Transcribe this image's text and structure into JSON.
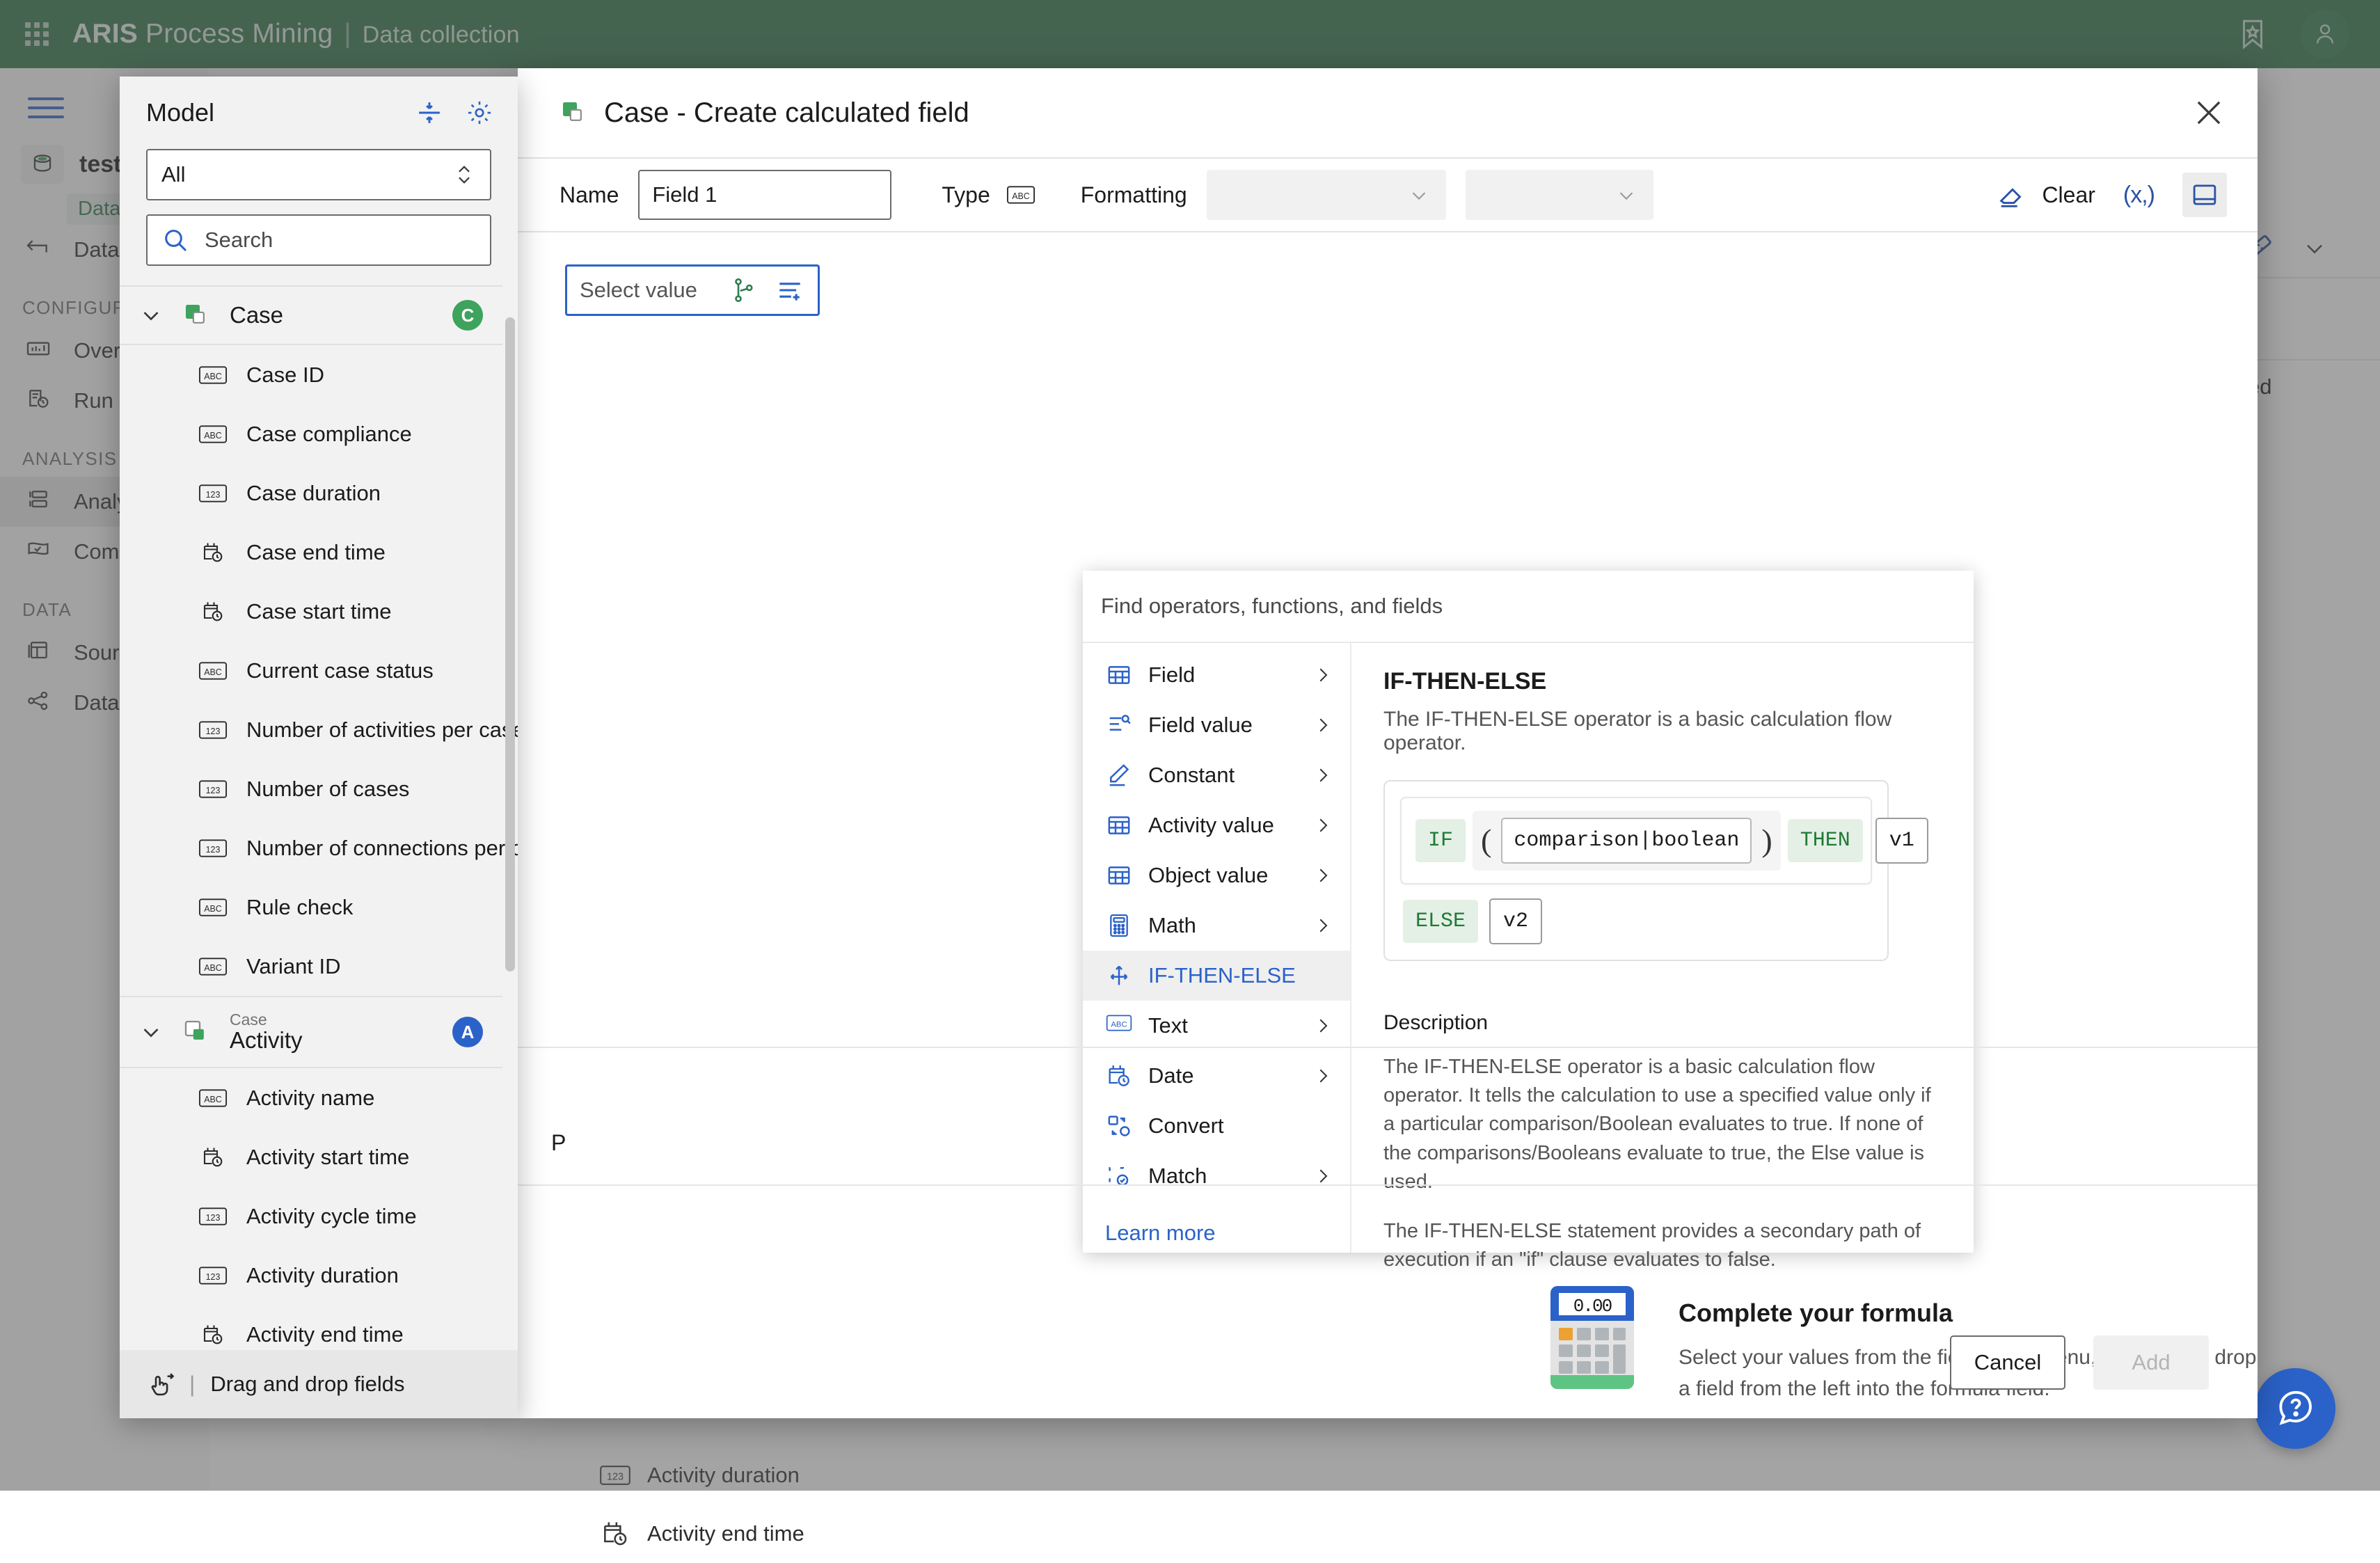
{
  "topbar": {
    "brand_bold": "ARIS",
    "brand_rest": " Process Mining",
    "separator": "|",
    "subtitle": "Data collection",
    "bookmark_icon": "bookmark-star-icon",
    "avatar_icon": "user-avatar-icon",
    "accent_color": "#2d7245"
  },
  "background_nav": {
    "db_name": "test",
    "chip": "Data ",
    "back_item": "Data s",
    "sections": [
      {
        "label": "CONFIGURA",
        "items": [
          "Overv",
          "Run lo"
        ]
      },
      {
        "label": "ANALYSIS",
        "items": [
          "Analys",
          "Comp"
        ]
      },
      {
        "label": "DATA",
        "items": [
          "Sourc",
          "Data r"
        ]
      }
    ],
    "selected_item": "Analys",
    "column_header": "ulated",
    "list_items": [
      "Activity duration",
      "Activity end time"
    ]
  },
  "help_fab": {
    "icon": "help-question-icon",
    "color": "#2b62c9"
  },
  "dialog": {
    "title": "Case - Create calculated field",
    "title_icon": "case-object-icon",
    "close_icon": "close-icon",
    "form": {
      "name_label": "Name",
      "name_value": "Field 1",
      "type_label": "Type",
      "type_icon": "abc-text-type-icon",
      "formatting_label": "Formatting",
      "formatting_value_1": "",
      "formatting_value_2": ""
    },
    "toolbar": {
      "clear_label": "Clear",
      "clear_icon": "eraser-icon",
      "fx_label": "(x,)",
      "panel_icon": "panel-layout-icon"
    },
    "formula": {
      "select_value_placeholder": "Select value",
      "hierarchy_icon": "branch-hierarchy-icon",
      "add_list_icon": "list-add-icon"
    },
    "operator_dropdown": {
      "search_placeholder": "Find operators, functions, and fields",
      "items": [
        {
          "label": "Field",
          "icon": "table-grid-icon",
          "has_submenu": true,
          "active": false
        },
        {
          "label": "Field value",
          "icon": "list-search-icon",
          "has_submenu": true,
          "active": false
        },
        {
          "label": "Constant",
          "icon": "pen-edit-icon",
          "has_submenu": true,
          "active": false
        },
        {
          "label": "Activity value",
          "icon": "table-grid-icon",
          "has_submenu": true,
          "active": false
        },
        {
          "label": "Object value",
          "icon": "table-grid-icon",
          "has_submenu": true,
          "active": false
        },
        {
          "label": "Math",
          "icon": "calculator-icon",
          "has_submenu": true,
          "active": false
        },
        {
          "label": "IF-THEN-ELSE",
          "icon": "branch-flow-icon",
          "has_submenu": false,
          "active": true
        },
        {
          "label": "Text",
          "icon": "abc-text-type-icon",
          "has_submenu": true,
          "active": false
        },
        {
          "label": "Date",
          "icon": "calendar-clock-icon",
          "has_submenu": true,
          "active": false
        },
        {
          "label": "Convert",
          "icon": "convert-shapes-icon",
          "has_submenu": false,
          "active": false
        },
        {
          "label": "Match",
          "icon": "match-check-icon",
          "has_submenu": true,
          "active": false
        }
      ],
      "learn_more": "Learn more",
      "detail": {
        "title": "IF-THEN-ELSE",
        "subtitle": "The IF-THEN-ELSE operator is a basic calculation flow operator.",
        "syntax": {
          "if_kw": "IF",
          "open_paren": "(",
          "condition_slot": "comparison|boolean",
          "close_paren": ")",
          "then_kw": "THEN",
          "then_value": "v1",
          "else_kw": "ELSE",
          "else_value": "v2"
        },
        "description_heading": "Description",
        "description_p1": "The IF-THEN-ELSE operator is a basic calculation flow operator. It tells the calculation to use a specified value only if a particular comparison/Boolean evaluates to true. If none of the comparisons/Booleans evaluate to true, the Else value is used.",
        "description_p2": "The IF-THEN-ELSE statement provides a secondary path of execution if an \"if\" clause evaluates to false."
      }
    },
    "empty_state": {
      "icon": "calculator-illustration",
      "display_value": "0.00",
      "title": "Complete your formula",
      "line1": "Select your values from the field-value menu, or drag and drop",
      "line2": "a field from the left into the formula field."
    },
    "preview_letter": "P",
    "footer": {
      "cancel_label": "Cancel",
      "add_label": "Add",
      "add_disabled": true
    }
  },
  "model_panel": {
    "title": "Model",
    "collapse_icon": "collapse-all-icon",
    "settings_icon": "gear-icon",
    "filter_value": "All",
    "filter_chevron_icon": "chevron-updown-icon",
    "search_icon": "search-icon",
    "search_placeholder": "Search",
    "groups": [
      {
        "name": "Case",
        "overline": "",
        "badge": "C",
        "badge_color": "#3da35d",
        "icon": "case-object-icon",
        "expanded": true,
        "fields": [
          {
            "label": "Case ID",
            "type_icon": "abc-text-type-icon"
          },
          {
            "label": "Case compliance",
            "type_icon": "abc-text-type-icon"
          },
          {
            "label": "Case duration",
            "type_icon": "123-number-type-icon"
          },
          {
            "label": "Case end time",
            "type_icon": "calendar-clock-icon"
          },
          {
            "label": "Case start time",
            "type_icon": "calendar-clock-icon"
          },
          {
            "label": "Current case status",
            "type_icon": "abc-text-type-icon"
          },
          {
            "label": "Number of activities per case",
            "type_icon": "123-number-type-icon"
          },
          {
            "label": "Number of cases",
            "type_icon": "123-number-type-icon"
          },
          {
            "label": "Number of connections per c...",
            "type_icon": "123-number-type-icon"
          },
          {
            "label": "Rule check",
            "type_icon": "abc-text-type-icon"
          },
          {
            "label": "Variant ID",
            "type_icon": "abc-text-type-icon"
          }
        ]
      },
      {
        "name": "Activity",
        "overline": "Case",
        "badge": "A",
        "badge_color": "#2b62c9",
        "icon": "activity-object-icon",
        "expanded": true,
        "fields": [
          {
            "label": "Activity name",
            "type_icon": "abc-text-type-icon"
          },
          {
            "label": "Activity start time",
            "type_icon": "calendar-clock-icon"
          },
          {
            "label": "Activity cycle time",
            "type_icon": "123-number-type-icon"
          },
          {
            "label": "Activity duration",
            "type_icon": "123-number-type-icon"
          },
          {
            "label": "Activity end time",
            "type_icon": "calendar-clock-icon"
          }
        ]
      }
    ],
    "footer_label": "Drag and drop fields",
    "footer_icon": "drag-drop-icon"
  }
}
